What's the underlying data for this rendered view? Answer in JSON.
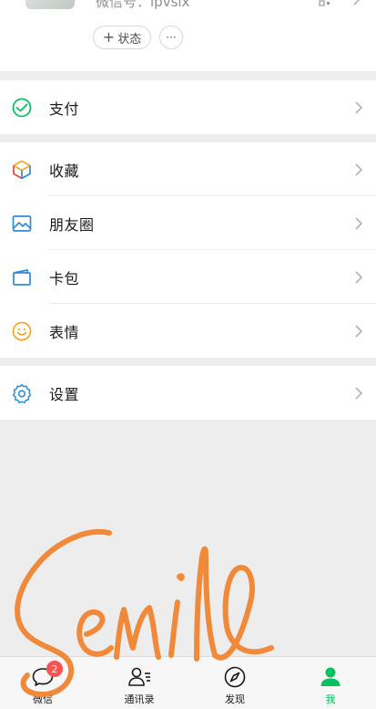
{
  "profile": {
    "wechat_id": "微信号：ipvsix",
    "status_button": "状态",
    "more_button": "···"
  },
  "menu": {
    "pay": {
      "label": "支付",
      "icon": "wechat-pay-icon"
    },
    "favorites": {
      "label": "收藏",
      "icon": "favorites-cube-icon"
    },
    "moments": {
      "label": "朋友圈",
      "icon": "moments-image-icon"
    },
    "cards": {
      "label": "卡包",
      "icon": "card-wallet-icon"
    },
    "stickers": {
      "label": "表情",
      "icon": "smiley-icon"
    },
    "settings": {
      "label": "设置",
      "icon": "gear-icon"
    }
  },
  "tabbar": {
    "chats": {
      "label": "微信",
      "badge": "2"
    },
    "contacts": {
      "label": "通讯录"
    },
    "discover": {
      "label": "发现"
    },
    "me": {
      "label": "我",
      "active": true
    }
  },
  "colors": {
    "accent_green": "#07c160",
    "badge_red": "#fa5151",
    "signature_orange": "#f08a3a",
    "icon_blue": "#2f8bd6"
  }
}
